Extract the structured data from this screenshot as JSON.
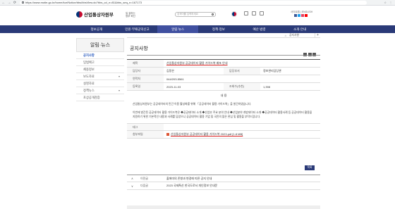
{
  "browser": {
    "back": "←",
    "forward": "→",
    "reload": "⟳",
    "url": "https://www.motie.go.kr/home/kor/Notice/bbs/bbsView.do?bbs_cd_n=81&bbs_seq_n=167173",
    "right_icons": [
      "☆",
      "⋮"
    ]
  },
  "header": {
    "logo_text": "산업통상자원부",
    "slogan_line1": "일 잘하는",
    "slogan_line2": "정부 혁신",
    "search_placeholder": "검색어를 입력하세요",
    "lang": "사이트맵 | ENGLISH",
    "sns_colors": [
      "#3b5998",
      "#1da1f2",
      "#e4405f",
      "#ff0000"
    ]
  },
  "gnb": {
    "items": [
      "정보공개",
      "민원·부패공익신고",
      "알림·뉴스",
      "정책·정보",
      "예산·법령",
      "소개·안내"
    ],
    "active_index": 2
  },
  "location": {
    "home": "⌂",
    "current": "공지사항",
    "plus": "+"
  },
  "lnb": {
    "title": "알림·뉴스",
    "items": [
      {
        "label": "공지사항",
        "arrow": ""
      },
      {
        "label": "입법예고",
        "arrow": ""
      },
      {
        "label": "채용정보",
        "arrow": ""
      },
      {
        "label": "보도자료",
        "arrow": "▾"
      },
      {
        "label": "설명자료",
        "arrow": ""
      },
      {
        "label": "정책뉴스",
        "arrow": "▾"
      },
      {
        "label": "포상공개검증",
        "arrow": ""
      }
    ]
  },
  "content": {
    "page_title": "공지사항",
    "table": {
      "title_label": "제목",
      "title_value": "산업통상자원부 공공데이터 활용 가이드북 배포 안내",
      "writer_label": "담당자",
      "writer_value": "김정은",
      "dept_label": "담당부서",
      "dept_value": "정보관리담당관",
      "phone_label": "연락처",
      "phone_value": "044/203-5561",
      "date_label": "등록일",
      "date_value": "2023-11-03",
      "views_label": "조회수(추천)",
      "views_value": "1,398"
    },
    "body_title": "내 용",
    "body_text1": "산업통상자원부는 공공데이터의 민간 이용 활성화를 위해 「공공데이터 활용 가이드북」을 발간하였습니다.",
    "body_text2": "이번에 발간된 공공데이터 활용 가이드북은 ◆공공데이터 소개 ◆산업부 주요 분야 안내 ◆산업분야 개방데이터 소개 ◆공공데이터 활용사례 등 공공데이터 활용을 지원하기 위한 기본적인 내용과 사례를 담았으니 공공데이터 활용 기업 및 국민의 많은 관심 및 활용을 부탁드립니다.",
    "tag_label": "태그",
    "tag_value": "",
    "attach_label": "첨부파일",
    "attach_value": "산업통상자원부 공공데이터 활용 가이드북 2023.pdf [1.8 MB]",
    "list_button": "목록",
    "prev_label": "이전글",
    "prev_text": "출애미의 존향과 변경에 따른 공지 안내",
    "next_label": "다음글",
    "next_text": "2023 국제특산 한국도로서 개인정보 안내문"
  }
}
